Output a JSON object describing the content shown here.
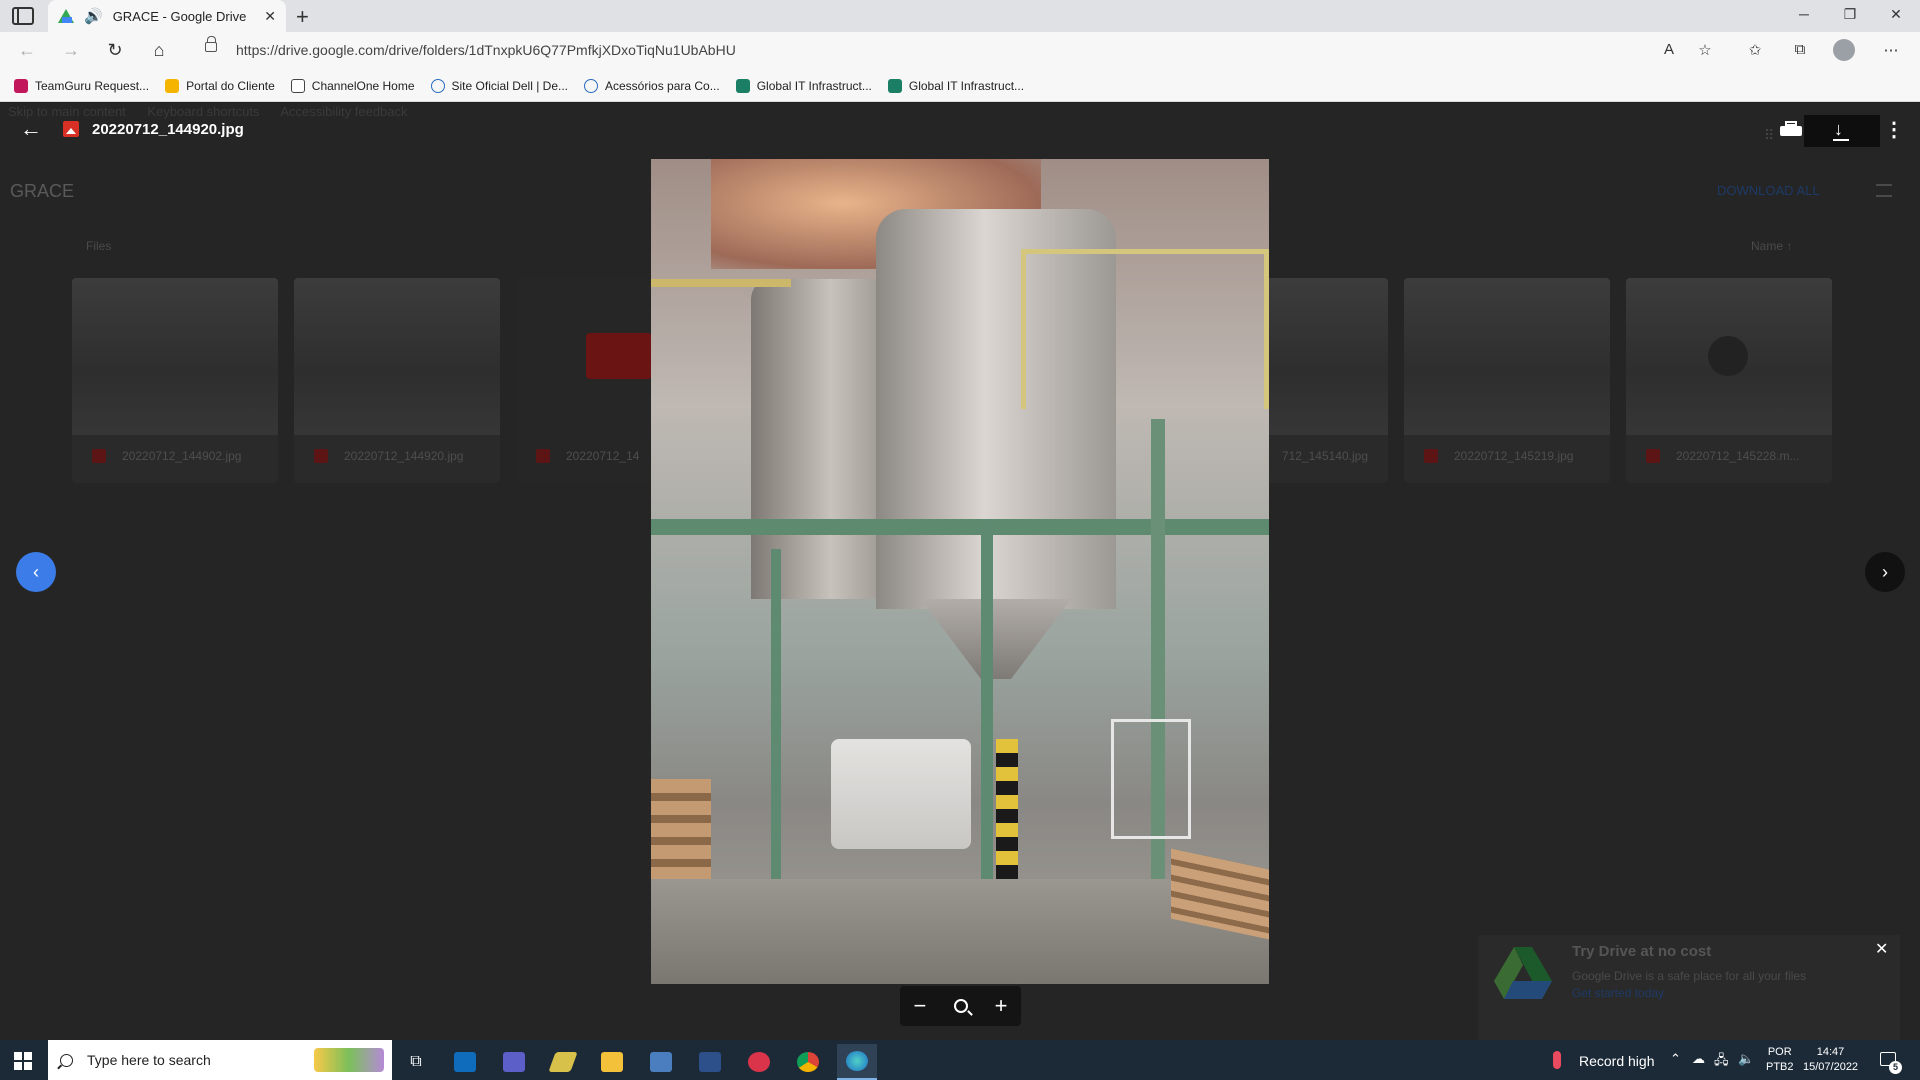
{
  "browser": {
    "tab_title": "GRACE - Google Drive",
    "address": "https://drive.google.com/drive/folders/1dTnxpkU6Q77PmfkjXDxoTiqNu1UbAbHU",
    "bookmarks": [
      {
        "label": "TeamGuru Request...",
        "color": "#c2185b"
      },
      {
        "label": "Portal do Cliente",
        "color": "#f4b400"
      },
      {
        "label": "ChannelOne Home",
        "color": "#ffffff"
      },
      {
        "label": "Site Oficial Dell | De...",
        "color": "#2a6dbf"
      },
      {
        "label": "Acessórios para Co...",
        "color": "#2a6dbf"
      },
      {
        "label": "Global IT Infrastruct...",
        "color": "#1a7f64"
      },
      {
        "label": "Global IT Infrastruct...",
        "color": "#1a7f64"
      }
    ]
  },
  "drive": {
    "skip_links": [
      "Skip to main content",
      "Keyboard shortcuts",
      "Accessibility feedback"
    ],
    "page_title": "GRACE",
    "download_all": "DOWNLOAD ALL",
    "files_label": "Files",
    "sort_label": "Name",
    "files": [
      {
        "name": "20220712_144902.jpg"
      },
      {
        "name": "20220712_144920.jpg"
      },
      {
        "name": "20220712_14"
      },
      {
        "name": "712_145140.jpg"
      },
      {
        "name": "20220712_145219.jpg"
      },
      {
        "name": "20220712_145228.m..."
      }
    ]
  },
  "viewer": {
    "file_name": "20220712_144920.jpg",
    "zoom_out": "−",
    "zoom_in": "+"
  },
  "promo": {
    "title": "Try Drive at no cost",
    "description": "Google Drive is a safe place for all your files",
    "link": "Get started today"
  },
  "taskbar": {
    "search_placeholder": "Type here to search",
    "weather": "Record high",
    "lang_line1": "POR",
    "lang_line2": "PTB2",
    "time": "14:47",
    "date": "15/07/2022",
    "notification_count": "5"
  }
}
